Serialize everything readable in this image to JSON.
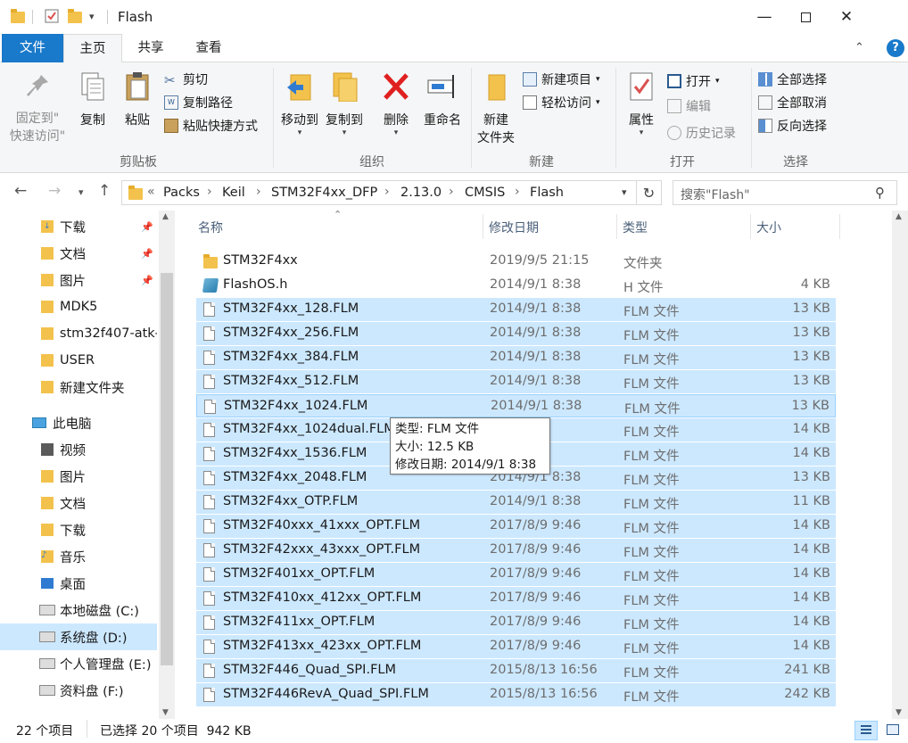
{
  "window": {
    "title": "Flash",
    "controls": [
      "minimize-icon",
      "maximize-icon",
      "close-icon"
    ]
  },
  "ribbon_tabs": [
    "文件",
    "主页",
    "共享",
    "查看"
  ],
  "ribbon": {
    "clipboard": {
      "group_label": "剪贴板",
      "pin_quick_access_1": "固定到\"",
      "pin_quick_access_2": "快速访问\"",
      "copy": "复制",
      "paste": "粘贴",
      "cut": "剪切",
      "copy_path": "复制路径",
      "paste_shortcut": "粘贴快捷方式"
    },
    "organize": {
      "group_label": "组织",
      "move_to": "移动到",
      "copy_to": "复制到",
      "delete": "删除",
      "rename": "重命名"
    },
    "new": {
      "group_label": "新建",
      "new_folder_1": "新建",
      "new_folder_2": "文件夹",
      "new_item": "新建项目",
      "easy_access": "轻松访问"
    },
    "open": {
      "group_label": "打开",
      "properties": "属性",
      "open": "打开",
      "edit": "编辑",
      "history": "历史记录"
    },
    "select": {
      "group_label": "选择",
      "select_all": "全部选择",
      "select_none": "全部取消",
      "invert": "反向选择"
    }
  },
  "address": {
    "overflow": "«",
    "crumbs": [
      "Packs",
      "Keil",
      "STM32F4xx_DFP",
      "2.13.0",
      "CMSIS",
      "Flash"
    ],
    "search_placeholder": "搜索\"Flash\""
  },
  "nav_pane": {
    "quick": [
      {
        "label": "下载",
        "pinned": true
      },
      {
        "label": "文档",
        "pinned": true
      },
      {
        "label": "图片",
        "pinned": true
      },
      {
        "label": "MDK5",
        "pinned": false
      },
      {
        "label": "stm32f407-atk-",
        "pinned": false
      },
      {
        "label": "USER",
        "pinned": false
      },
      {
        "label": "新建文件夹",
        "pinned": false
      }
    ],
    "this_pc": "此电脑",
    "pc_items": [
      "视频",
      "图片",
      "文档",
      "下载",
      "音乐",
      "桌面",
      "本地磁盘 (C:)",
      "系统盘 (D:)",
      "个人管理盘 (E:)",
      "资料盘 (F:)"
    ]
  },
  "columns": {
    "name": "名称",
    "date": "修改日期",
    "type": "类型",
    "size": "大小"
  },
  "files": [
    {
      "name": "STM32F4xx",
      "date": "2019/9/5 21:15",
      "type": "文件夹",
      "size": "",
      "kind": "folder",
      "selected": false
    },
    {
      "name": "FlashOS.h",
      "date": "2014/9/1 8:38",
      "type": "H 文件",
      "size": "4 KB",
      "kind": "h",
      "selected": false
    },
    {
      "name": "STM32F4xx_128.FLM",
      "date": "2014/9/1 8:38",
      "type": "FLM 文件",
      "size": "13 KB",
      "kind": "file",
      "selected": true
    },
    {
      "name": "STM32F4xx_256.FLM",
      "date": "2014/9/1 8:38",
      "type": "FLM 文件",
      "size": "13 KB",
      "kind": "file",
      "selected": true
    },
    {
      "name": "STM32F4xx_384.FLM",
      "date": "2014/9/1 8:38",
      "type": "FLM 文件",
      "size": "13 KB",
      "kind": "file",
      "selected": true
    },
    {
      "name": "STM32F4xx_512.FLM",
      "date": "2014/9/1 8:38",
      "type": "FLM 文件",
      "size": "13 KB",
      "kind": "file",
      "selected": true
    },
    {
      "name": "STM32F4xx_1024.FLM",
      "date": "2014/9/1 8:38",
      "type": "FLM 文件",
      "size": "13 KB",
      "kind": "file",
      "selected": true
    },
    {
      "name": "STM32F4xx_1024dual.FLM",
      "date": "2 10:41",
      "type": "FLM 文件",
      "size": "14 KB",
      "kind": "file",
      "selected": true
    },
    {
      "name": "STM32F4xx_1536.FLM",
      "date": "5 10:06",
      "type": "FLM 文件",
      "size": "14 KB",
      "kind": "file",
      "selected": true
    },
    {
      "name": "STM32F4xx_2048.FLM",
      "date": "2014/9/1 8:38",
      "type": "FLM 文件",
      "size": "13 KB",
      "kind": "file",
      "selected": true
    },
    {
      "name": "STM32F4xx_OTP.FLM",
      "date": "2014/9/1 8:38",
      "type": "FLM 文件",
      "size": "11 KB",
      "kind": "file",
      "selected": true
    },
    {
      "name": "STM32F40xxx_41xxx_OPT.FLM",
      "date": "2017/8/9 9:46",
      "type": "FLM 文件",
      "size": "14 KB",
      "kind": "file",
      "selected": true
    },
    {
      "name": "STM32F42xxx_43xxx_OPT.FLM",
      "date": "2017/8/9 9:46",
      "type": "FLM 文件",
      "size": "14 KB",
      "kind": "file",
      "selected": true
    },
    {
      "name": "STM32F401xx_OPT.FLM",
      "date": "2017/8/9 9:46",
      "type": "FLM 文件",
      "size": "14 KB",
      "kind": "file",
      "selected": true
    },
    {
      "name": "STM32F410xx_412xx_OPT.FLM",
      "date": "2017/8/9 9:46",
      "type": "FLM 文件",
      "size": "14 KB",
      "kind": "file",
      "selected": true
    },
    {
      "name": "STM32F411xx_OPT.FLM",
      "date": "2017/8/9 9:46",
      "type": "FLM 文件",
      "size": "14 KB",
      "kind": "file",
      "selected": true
    },
    {
      "name": "STM32F413xx_423xx_OPT.FLM",
      "date": "2017/8/9 9:46",
      "type": "FLM 文件",
      "size": "14 KB",
      "kind": "file",
      "selected": true
    },
    {
      "name": "STM32F446_Quad_SPI.FLM",
      "date": "2015/8/13 16:56",
      "type": "FLM 文件",
      "size": "241 KB",
      "kind": "file",
      "selected": true
    },
    {
      "name": "STM32F446RevA_Quad_SPI.FLM",
      "date": "2015/8/13 16:56",
      "type": "FLM 文件",
      "size": "242 KB",
      "kind": "file",
      "selected": true
    }
  ],
  "tooltip": {
    "type_line": "类型: FLM 文件",
    "size_line": "大小: 12.5 KB",
    "date_line": "修改日期: 2014/9/1 8:38"
  },
  "status": {
    "item_count": "22 个项目",
    "selection": "已选择 20 个项目  942 KB"
  },
  "colors": {
    "accent": "#1979ca",
    "selection": "#cce8ff",
    "focus_border": "#99d1ff"
  }
}
